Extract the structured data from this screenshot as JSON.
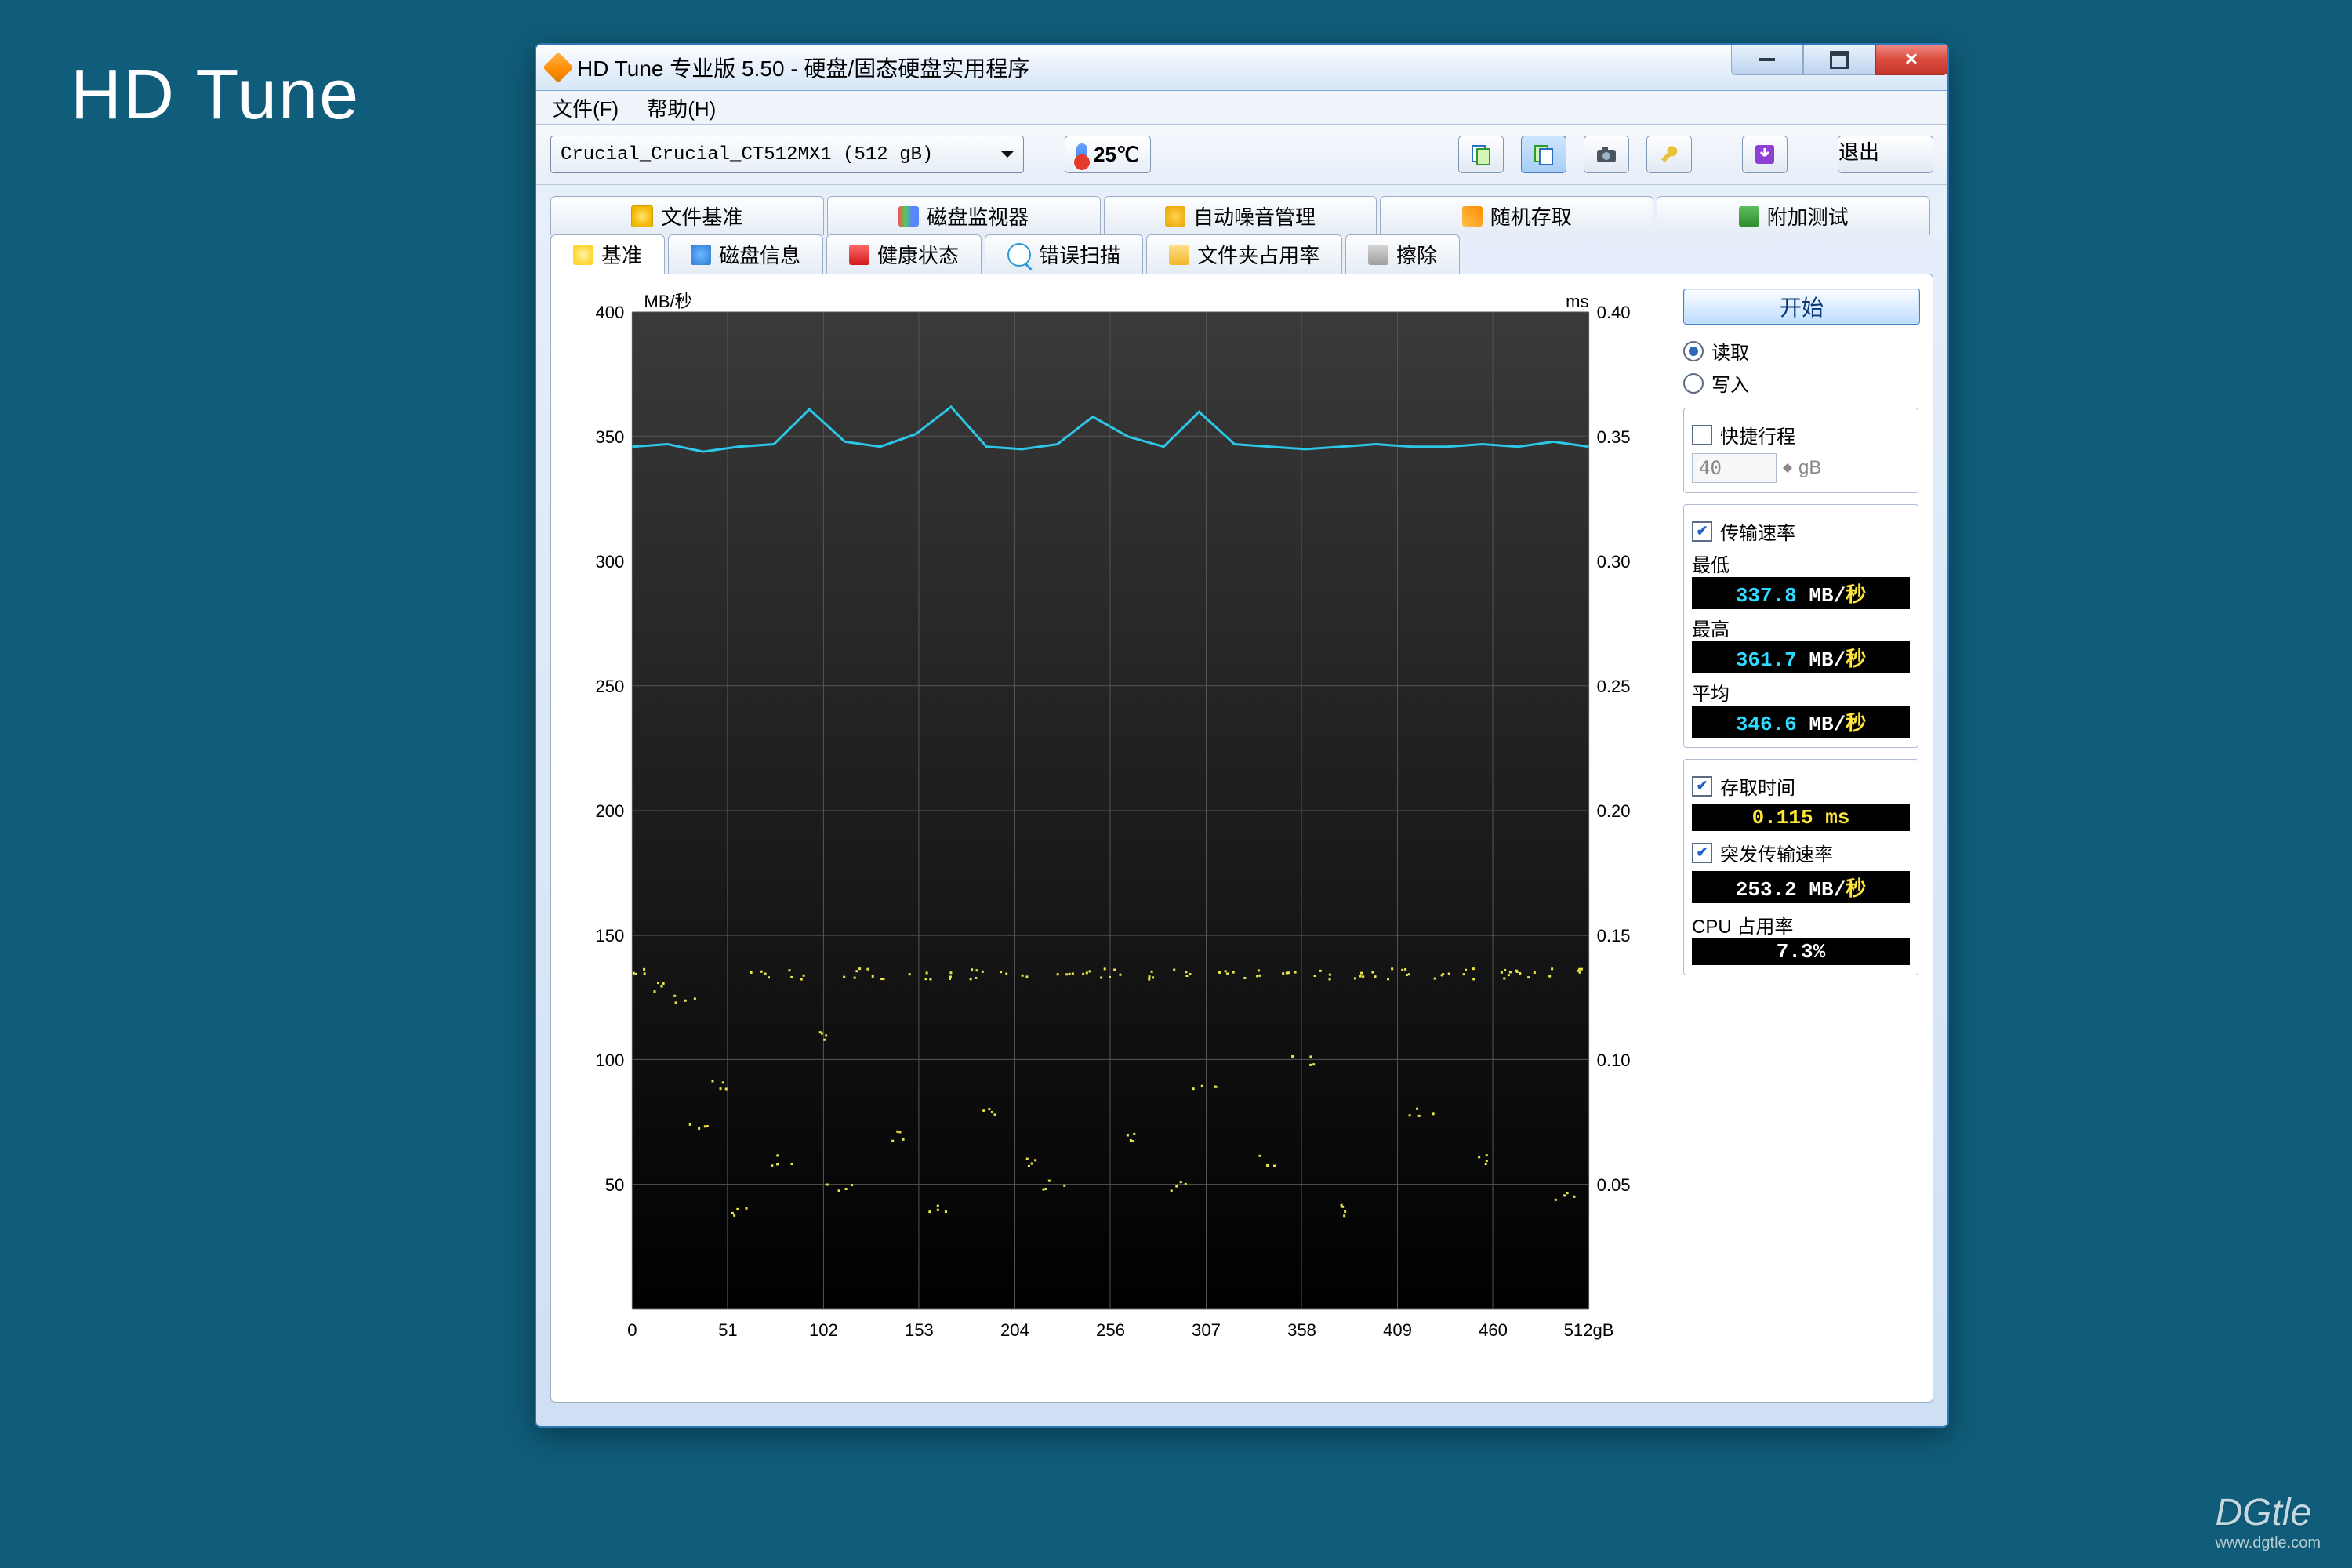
{
  "slide": {
    "title": "HD Tune",
    "watermark": "DGtle",
    "watermark_sub": "www.dgtle.com"
  },
  "window": {
    "title": "HD Tune 专业版 5.50 - 硬盘/固态硬盘实用程序",
    "menu": {
      "file": "文件(F)",
      "help": "帮助(H)"
    },
    "drive": "Crucial_Crucial_CT512MX1 (512 gB)",
    "temperature": "25℃",
    "exit_label": "退出"
  },
  "tabs_top": [
    {
      "label": "文件基准"
    },
    {
      "label": "磁盘监视器"
    },
    {
      "label": "自动噪音管理"
    },
    {
      "label": "随机存取"
    },
    {
      "label": "附加测试"
    }
  ],
  "tabs_bottom": [
    {
      "label": "基准"
    },
    {
      "label": "磁盘信息"
    },
    {
      "label": "健康状态"
    },
    {
      "label": "错误扫描"
    },
    {
      "label": "文件夹占用率"
    },
    {
      "label": "擦除"
    }
  ],
  "side": {
    "start": "开始",
    "read": "读取",
    "write": "写入",
    "quick": "快捷行程",
    "quick_value": "40",
    "quick_unit": "gB",
    "transfer_header": "传输速率",
    "min_label": "最低",
    "min_value": "337.8",
    "min_unit": "MB/秒",
    "max_label": "最高",
    "max_value": "361.7",
    "max_unit": "MB/秒",
    "avg_label": "平均",
    "avg_value": "346.6",
    "avg_unit": "MB/秒",
    "access_label": "存取时间",
    "access_value": "0.115",
    "access_unit": "ms",
    "burst_label": "突发传输速率",
    "burst_value": "253.2",
    "burst_unit": "MB/秒",
    "cpu_label": "CPU 占用率",
    "cpu_value": "7.3%"
  },
  "chart_data": {
    "type": "line",
    "title": "",
    "x_unit": "gB",
    "left_axis": {
      "label": "MB/秒",
      "min": 0,
      "max": 400,
      "step": 50
    },
    "right_axis": {
      "label": "ms",
      "min": 0,
      "max": 0.4,
      "step": 0.05
    },
    "x": [
      0,
      51,
      102,
      153,
      204,
      256,
      307,
      358,
      409,
      460,
      512
    ],
    "series": [
      {
        "name": "传输速率 (MB/秒)",
        "axis": "left",
        "color": "#2cc7e6",
        "values": [
          346,
          347,
          344,
          346,
          347,
          361,
          348,
          346,
          351,
          362,
          346,
          345,
          347,
          358,
          350,
          346,
          360,
          347,
          346,
          345,
          346,
          347,
          346,
          346,
          347,
          346,
          348,
          346
        ]
      },
      {
        "name": "存取时间 (ms)",
        "axis": "right",
        "style": "scatter",
        "color": "#e8e44a",
        "values": [
          0.135,
          0.13,
          0.125,
          0.075,
          0.09,
          0.04,
          0.135,
          0.06,
          0.135,
          0.11,
          0.05,
          0.135,
          0.135,
          0.07,
          0.135,
          0.04,
          0.135,
          0.135,
          0.08,
          0.135,
          0.06,
          0.05,
          0.135,
          0.135,
          0.135,
          0.07,
          0.135,
          0.05,
          0.135,
          0.09,
          0.135,
          0.135,
          0.06,
          0.135,
          0.1,
          0.135,
          0.04,
          0.135,
          0.135,
          0.135,
          0.08,
          0.135,
          0.135,
          0.06,
          0.135,
          0.135,
          0.135,
          0.045,
          0.135
        ]
      }
    ]
  }
}
